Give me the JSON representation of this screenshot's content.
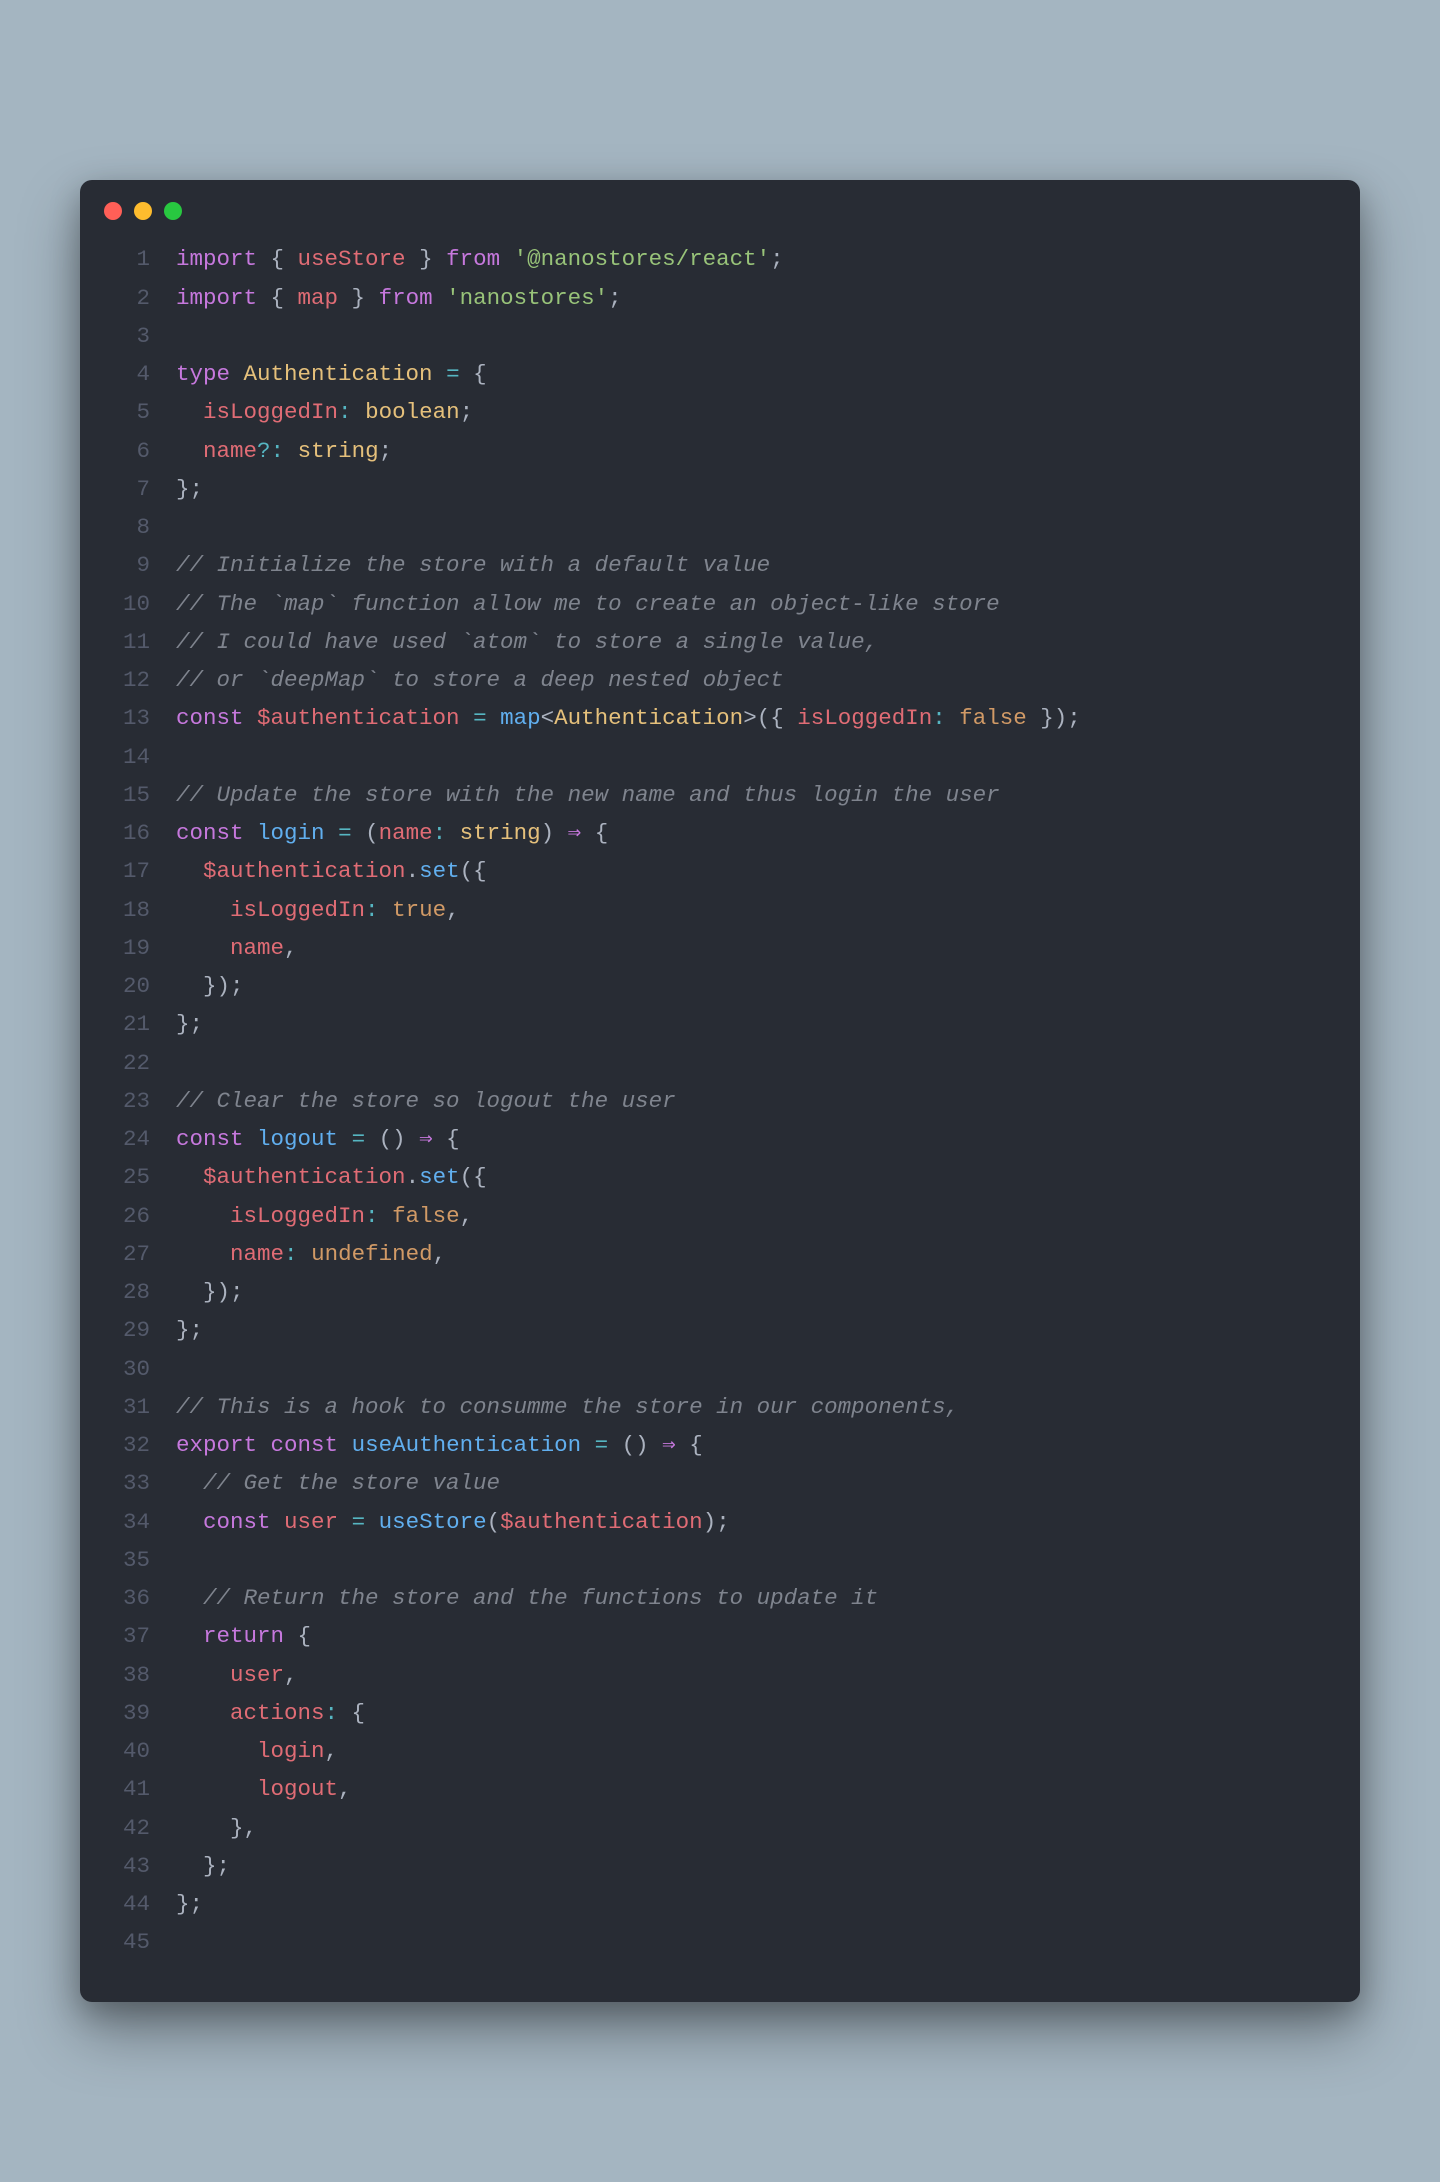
{
  "code": {
    "lines": [
      [
        {
          "c": "kw",
          "t": "import"
        },
        {
          "c": "pln",
          "t": " { "
        },
        {
          "c": "prop",
          "t": "useStore"
        },
        {
          "c": "pln",
          "t": " } "
        },
        {
          "c": "kw",
          "t": "from"
        },
        {
          "c": "pln",
          "t": " "
        },
        {
          "c": "str",
          "t": "'@nanostores/react'"
        },
        {
          "c": "pln",
          "t": ";"
        }
      ],
      [
        {
          "c": "kw",
          "t": "import"
        },
        {
          "c": "pln",
          "t": " { "
        },
        {
          "c": "prop",
          "t": "map"
        },
        {
          "c": "pln",
          "t": " } "
        },
        {
          "c": "kw",
          "t": "from"
        },
        {
          "c": "pln",
          "t": " "
        },
        {
          "c": "str",
          "t": "'nanostores'"
        },
        {
          "c": "pln",
          "t": ";"
        }
      ],
      [],
      [
        {
          "c": "kw",
          "t": "type"
        },
        {
          "c": "pln",
          "t": " "
        },
        {
          "c": "type",
          "t": "Authentication"
        },
        {
          "c": "pln",
          "t": " "
        },
        {
          "c": "op",
          "t": "="
        },
        {
          "c": "pln",
          "t": " {"
        }
      ],
      [
        {
          "c": "pln",
          "t": "  "
        },
        {
          "c": "prop",
          "t": "isLoggedIn"
        },
        {
          "c": "op",
          "t": ":"
        },
        {
          "c": "pln",
          "t": " "
        },
        {
          "c": "type",
          "t": "boolean"
        },
        {
          "c": "pln",
          "t": ";"
        }
      ],
      [
        {
          "c": "pln",
          "t": "  "
        },
        {
          "c": "prop",
          "t": "name"
        },
        {
          "c": "op",
          "t": "?:"
        },
        {
          "c": "pln",
          "t": " "
        },
        {
          "c": "type",
          "t": "string"
        },
        {
          "c": "pln",
          "t": ";"
        }
      ],
      [
        {
          "c": "pln",
          "t": "};"
        }
      ],
      [],
      [
        {
          "c": "cmt",
          "t": "// Initialize the store with a default value"
        }
      ],
      [
        {
          "c": "cmt",
          "t": "// The `map` function allow me to create an object-like store"
        }
      ],
      [
        {
          "c": "cmt",
          "t": "// I could have used `atom` to store a single value,"
        }
      ],
      [
        {
          "c": "cmt",
          "t": "// or `deepMap` to store a deep nested object"
        }
      ],
      [
        {
          "c": "kw",
          "t": "const"
        },
        {
          "c": "pln",
          "t": " "
        },
        {
          "c": "prop",
          "t": "$authentication"
        },
        {
          "c": "pln",
          "t": " "
        },
        {
          "c": "op",
          "t": "="
        },
        {
          "c": "pln",
          "t": " "
        },
        {
          "c": "fn",
          "t": "map"
        },
        {
          "c": "pln",
          "t": "<"
        },
        {
          "c": "type",
          "t": "Authentication"
        },
        {
          "c": "pln",
          "t": ">({ "
        },
        {
          "c": "prop",
          "t": "isLoggedIn"
        },
        {
          "c": "op",
          "t": ":"
        },
        {
          "c": "pln",
          "t": " "
        },
        {
          "c": "num",
          "t": "false"
        },
        {
          "c": "pln",
          "t": " });"
        }
      ],
      [],
      [
        {
          "c": "cmt",
          "t": "// Update the store with the new name and thus login the user"
        }
      ],
      [
        {
          "c": "kw",
          "t": "const"
        },
        {
          "c": "pln",
          "t": " "
        },
        {
          "c": "fn",
          "t": "login"
        },
        {
          "c": "pln",
          "t": " "
        },
        {
          "c": "op",
          "t": "="
        },
        {
          "c": "pln",
          "t": " ("
        },
        {
          "c": "prop",
          "t": "name"
        },
        {
          "c": "op",
          "t": ":"
        },
        {
          "c": "pln",
          "t": " "
        },
        {
          "c": "type",
          "t": "string"
        },
        {
          "c": "pln",
          "t": ") "
        },
        {
          "c": "arrow",
          "t": "⇒"
        },
        {
          "c": "pln",
          "t": " {"
        }
      ],
      [
        {
          "c": "pln",
          "t": "  "
        },
        {
          "c": "prop",
          "t": "$authentication"
        },
        {
          "c": "pln",
          "t": "."
        },
        {
          "c": "fn",
          "t": "set"
        },
        {
          "c": "pln",
          "t": "({"
        }
      ],
      [
        {
          "c": "pln",
          "t": "    "
        },
        {
          "c": "prop",
          "t": "isLoggedIn"
        },
        {
          "c": "op",
          "t": ":"
        },
        {
          "c": "pln",
          "t": " "
        },
        {
          "c": "num",
          "t": "true"
        },
        {
          "c": "pln",
          "t": ","
        }
      ],
      [
        {
          "c": "pln",
          "t": "    "
        },
        {
          "c": "prop",
          "t": "name"
        },
        {
          "c": "pln",
          "t": ","
        }
      ],
      [
        {
          "c": "pln",
          "t": "  });"
        }
      ],
      [
        {
          "c": "pln",
          "t": "};"
        }
      ],
      [],
      [
        {
          "c": "cmt",
          "t": "// Clear the store so logout the user"
        }
      ],
      [
        {
          "c": "kw",
          "t": "const"
        },
        {
          "c": "pln",
          "t": " "
        },
        {
          "c": "fn",
          "t": "logout"
        },
        {
          "c": "pln",
          "t": " "
        },
        {
          "c": "op",
          "t": "="
        },
        {
          "c": "pln",
          "t": " () "
        },
        {
          "c": "arrow",
          "t": "⇒"
        },
        {
          "c": "pln",
          "t": " {"
        }
      ],
      [
        {
          "c": "pln",
          "t": "  "
        },
        {
          "c": "prop",
          "t": "$authentication"
        },
        {
          "c": "pln",
          "t": "."
        },
        {
          "c": "fn",
          "t": "set"
        },
        {
          "c": "pln",
          "t": "({"
        }
      ],
      [
        {
          "c": "pln",
          "t": "    "
        },
        {
          "c": "prop",
          "t": "isLoggedIn"
        },
        {
          "c": "op",
          "t": ":"
        },
        {
          "c": "pln",
          "t": " "
        },
        {
          "c": "num",
          "t": "false"
        },
        {
          "c": "pln",
          "t": ","
        }
      ],
      [
        {
          "c": "pln",
          "t": "    "
        },
        {
          "c": "prop",
          "t": "name"
        },
        {
          "c": "op",
          "t": ":"
        },
        {
          "c": "pln",
          "t": " "
        },
        {
          "c": "num",
          "t": "undefined"
        },
        {
          "c": "pln",
          "t": ","
        }
      ],
      [
        {
          "c": "pln",
          "t": "  });"
        }
      ],
      [
        {
          "c": "pln",
          "t": "};"
        }
      ],
      [],
      [
        {
          "c": "cmt",
          "t": "// This is a hook to consumme the store in our components,"
        }
      ],
      [
        {
          "c": "kw",
          "t": "export"
        },
        {
          "c": "pln",
          "t": " "
        },
        {
          "c": "kw",
          "t": "const"
        },
        {
          "c": "pln",
          "t": " "
        },
        {
          "c": "fn",
          "t": "useAuthentication"
        },
        {
          "c": "pln",
          "t": " "
        },
        {
          "c": "op",
          "t": "="
        },
        {
          "c": "pln",
          "t": " () "
        },
        {
          "c": "arrow",
          "t": "⇒"
        },
        {
          "c": "pln",
          "t": " {"
        }
      ],
      [
        {
          "c": "pln",
          "t": "  "
        },
        {
          "c": "cmt",
          "t": "// Get the store value"
        }
      ],
      [
        {
          "c": "pln",
          "t": "  "
        },
        {
          "c": "kw",
          "t": "const"
        },
        {
          "c": "pln",
          "t": " "
        },
        {
          "c": "prop",
          "t": "user"
        },
        {
          "c": "pln",
          "t": " "
        },
        {
          "c": "op",
          "t": "="
        },
        {
          "c": "pln",
          "t": " "
        },
        {
          "c": "fn",
          "t": "useStore"
        },
        {
          "c": "pln",
          "t": "("
        },
        {
          "c": "prop",
          "t": "$authentication"
        },
        {
          "c": "pln",
          "t": ");"
        }
      ],
      [],
      [
        {
          "c": "pln",
          "t": "  "
        },
        {
          "c": "cmt",
          "t": "// Return the store and the functions to update it"
        }
      ],
      [
        {
          "c": "pln",
          "t": "  "
        },
        {
          "cPIXELS": "kw",
          "c": "kw",
          "t": "return"
        },
        {
          "c": "pln",
          "t": " {"
        }
      ],
      [
        {
          "c": "pln",
          "t": "    "
        },
        {
          "c": "prop",
          "t": "user"
        },
        {
          "c": "pln",
          "t": ","
        }
      ],
      [
        {
          "c": "pln",
          "t": "    "
        },
        {
          "c": "prop",
          "t": "actions"
        },
        {
          "c": "op",
          "t": ":"
        },
        {
          "c": "pln",
          "t": " {"
        }
      ],
      [
        {
          "c": "pln",
          "t": "      "
        },
        {
          "c": "prop",
          "t": "login"
        },
        {
          "c": "pln",
          "t": ","
        }
      ],
      [
        {
          "c": "pln",
          "t": "      "
        },
        {
          "c": "prop",
          "t": "logout"
        },
        {
          "c": "pln",
          "t": ","
        }
      ],
      [
        {
          "c": "pln",
          "t": "    },"
        }
      ],
      [
        {
          "c": "pln",
          "t": "  };"
        }
      ],
      [
        {
          "c": "pln",
          "t": "};"
        }
      ],
      []
    ]
  }
}
